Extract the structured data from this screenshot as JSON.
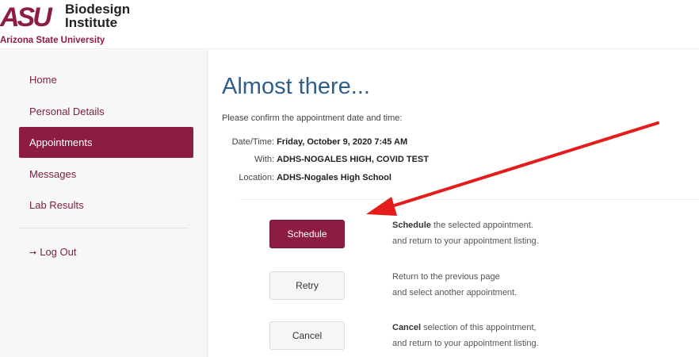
{
  "header": {
    "logo_mark": "ASU",
    "logo_title_line1": "Biodesign",
    "logo_title_line2": "Institute",
    "logo_subtitle": "Arizona State University"
  },
  "sidebar": {
    "items": [
      {
        "label": "Home",
        "active": false
      },
      {
        "label": "Personal Details",
        "active": false
      },
      {
        "label": "Appointments",
        "active": true
      },
      {
        "label": "Messages",
        "active": false
      },
      {
        "label": "Lab Results",
        "active": false
      }
    ],
    "logout_label": "Log Out",
    "logout_icon": "log-out-icon"
  },
  "main": {
    "title": "Almost there...",
    "subtitle": "Please confirm the appointment date and time:",
    "details": [
      {
        "label": "Date/Time:",
        "value": "Friday, October 9, 2020 7:45 AM"
      },
      {
        "label": "With:",
        "value": "ADHS-NOGALES HIGH, COVID TEST"
      },
      {
        "label": "Location:",
        "value": "ADHS-Nogales High School"
      }
    ],
    "actions": {
      "schedule": {
        "button": "Schedule",
        "desc_bold": "Schedule",
        "desc_line1": " the selected appointment.",
        "desc_line2": "and return to your appointment listing."
      },
      "retry": {
        "button": "Retry",
        "desc_line1": "Return to the previous page",
        "desc_line2": "and select another appointment."
      },
      "cancel": {
        "button": "Cancel",
        "desc_bold": "Cancel",
        "desc_line1": " selection of this appointment,",
        "desc_line2": "and return to your appointment listing."
      }
    }
  },
  "colors": {
    "brand_maroon": "#8c1d40",
    "title_blue": "#2e5f8a",
    "annotation_arrow": "#e41c1c"
  }
}
